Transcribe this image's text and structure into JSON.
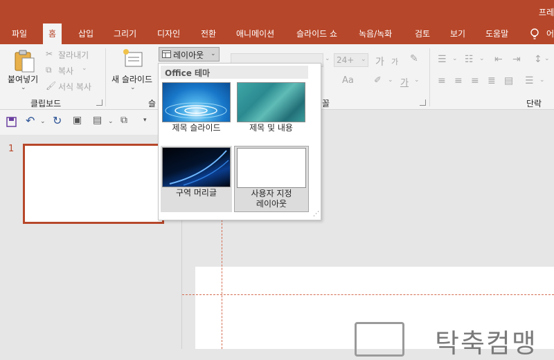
{
  "window": {
    "title": "프레"
  },
  "tabs": [
    {
      "id": "file",
      "label": "파일"
    },
    {
      "id": "home",
      "label": "홈"
    },
    {
      "id": "insert",
      "label": "삽입"
    },
    {
      "id": "draw",
      "label": "그리기"
    },
    {
      "id": "design",
      "label": "디자인"
    },
    {
      "id": "transitions",
      "label": "전환"
    },
    {
      "id": "animations",
      "label": "애니메이션"
    },
    {
      "id": "slideshow",
      "label": "슬라이드 쇼"
    },
    {
      "id": "record",
      "label": "녹음/녹화"
    },
    {
      "id": "review",
      "label": "검토"
    },
    {
      "id": "view",
      "label": "보기"
    },
    {
      "id": "help",
      "label": "도움말"
    },
    {
      "id": "tellme",
      "label": "어"
    }
  ],
  "ribbon": {
    "clipboard": {
      "paste": "붙여넣기",
      "cut": "잘라내기",
      "copy": "복사",
      "format_painter": "서식 복사",
      "group": "클립보드"
    },
    "slides": {
      "new_slide": "새 슬라이드",
      "layout": "레이아웃",
      "group": "슬"
    },
    "font": {
      "size": "24+",
      "group": "꼴",
      "grow": "가",
      "shrink": "가",
      "aa": "Aa",
      "color_a": "가"
    },
    "paragraph": {
      "group": "단락"
    }
  },
  "layout_menu": {
    "header": "Office 테마",
    "items": [
      {
        "label": "제목 슬라이드"
      },
      {
        "label": "제목 및 내용"
      },
      {
        "label": "구역 머리글"
      },
      {
        "label1": "사용자 지정",
        "label2": "레이아웃"
      }
    ]
  },
  "slides_pane": {
    "slide_number": "1"
  },
  "editor": {
    "title_placeholder": "탁축컴맹"
  },
  "colors": {
    "accent": "#b7472a",
    "ribbon_bg": "#f3f3f3"
  }
}
